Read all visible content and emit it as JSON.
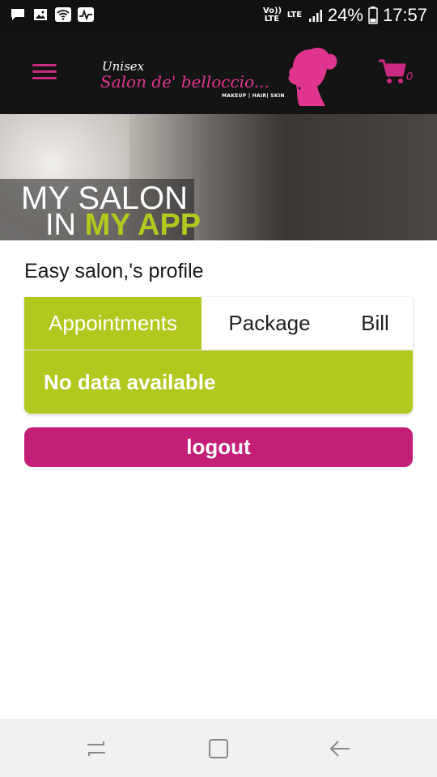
{
  "status_bar": {
    "network_label": "Vo)) LTE",
    "lte_label": "LTE",
    "battery": "24%",
    "time": "17:57",
    "icons": [
      "chat-icon",
      "image-icon",
      "wifi-icon",
      "activity-icon",
      "signal-icon",
      "battery-icon"
    ]
  },
  "header": {
    "logo_unisex": "Unisex",
    "logo_name": "Salon de' belloccio...",
    "logo_sub": "MAKEUP | HAIR| SKIN",
    "cart_count": "0"
  },
  "banner": {
    "line1": "MY SALON",
    "line2_prefix": "IN",
    "line2_highlight": "MY APP"
  },
  "profile": {
    "title": "Easy salon,'s profile",
    "tabs": [
      {
        "label": "Appointments",
        "active": true
      },
      {
        "label": "Package",
        "active": false
      },
      {
        "label": "Bill",
        "active": false
      }
    ],
    "empty_message": "No data available",
    "logout_label": "logout"
  },
  "colors": {
    "brand_pink": "#c41f76",
    "accent_green": "#b1c91e",
    "header_bg": "#141414"
  }
}
